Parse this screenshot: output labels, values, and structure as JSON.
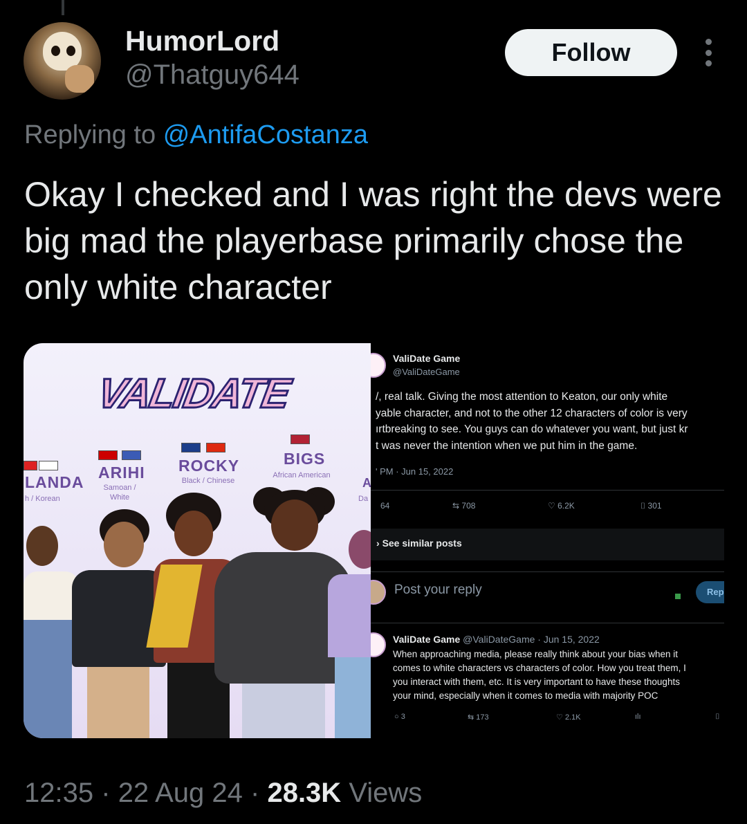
{
  "tweet": {
    "author_name": "HumorLord",
    "author_handle": "@Thatguy644",
    "follow_label": "Follow",
    "replying_prefix": "Replying to",
    "replying_to": "@AntifaCostanza",
    "text": "Okay I checked and I was right the devs were big mad the playerbase primarily chose the only white character",
    "time": "12:35",
    "sep1": "·",
    "date": "22 Aug 24",
    "sep2": "·",
    "views_count": "28.3K",
    "views_label": "Views"
  },
  "artwork": {
    "logo": "VALIDATE",
    "characters": [
      {
        "name": "LANDA",
        "sub": "h / Korean"
      },
      {
        "name": "ARIHI",
        "sub": "Samoan / White"
      },
      {
        "name": "ROCKY",
        "sub": "Black / Chinese"
      },
      {
        "name": "BIGS",
        "sub": "African American"
      }
    ],
    "partial_label_a": "A",
    "partial_label_b": "Da"
  },
  "screenshot": {
    "name": "ValiDate Game",
    "handle": "@ValiDateGame",
    "text_lines": [
      "/, real talk. Giving the most attention to Keaton, our only white",
      "yable character, and not to the other 12 characters of color is very",
      "ırtbreaking to see. You guys can do whatever you want, but just kr",
      "t was never the intention when we put him in the game."
    ],
    "meta": "' PM · Jun 15, 2022",
    "stats": {
      "replies": "64",
      "reposts": "708",
      "likes": "6.2K",
      "bookmarks": "301"
    },
    "see_similar": "See similar posts",
    "post_reply_placeholder": "Post your reply",
    "reply_button": "Rep",
    "reply": {
      "name": "ValiDate Game",
      "handle_date": "@ValiDateGame · Jun 15, 2022",
      "lines": [
        "When approaching media, please really think about your bias when it",
        "comes to white characters vs characters of color. How you treat them, I",
        "you interact with them, etc. It is very important to have these thoughts",
        "your mind, especially when it comes to media with majority POC"
      ],
      "stats": {
        "replies": "3",
        "reposts": "173",
        "likes": "2.1K"
      }
    }
  },
  "colors": {
    "background": "#000000",
    "text": "#e7e9ea",
    "muted": "#71767b",
    "link": "#1d9bf0",
    "follow_bg": "#eff3f4"
  }
}
